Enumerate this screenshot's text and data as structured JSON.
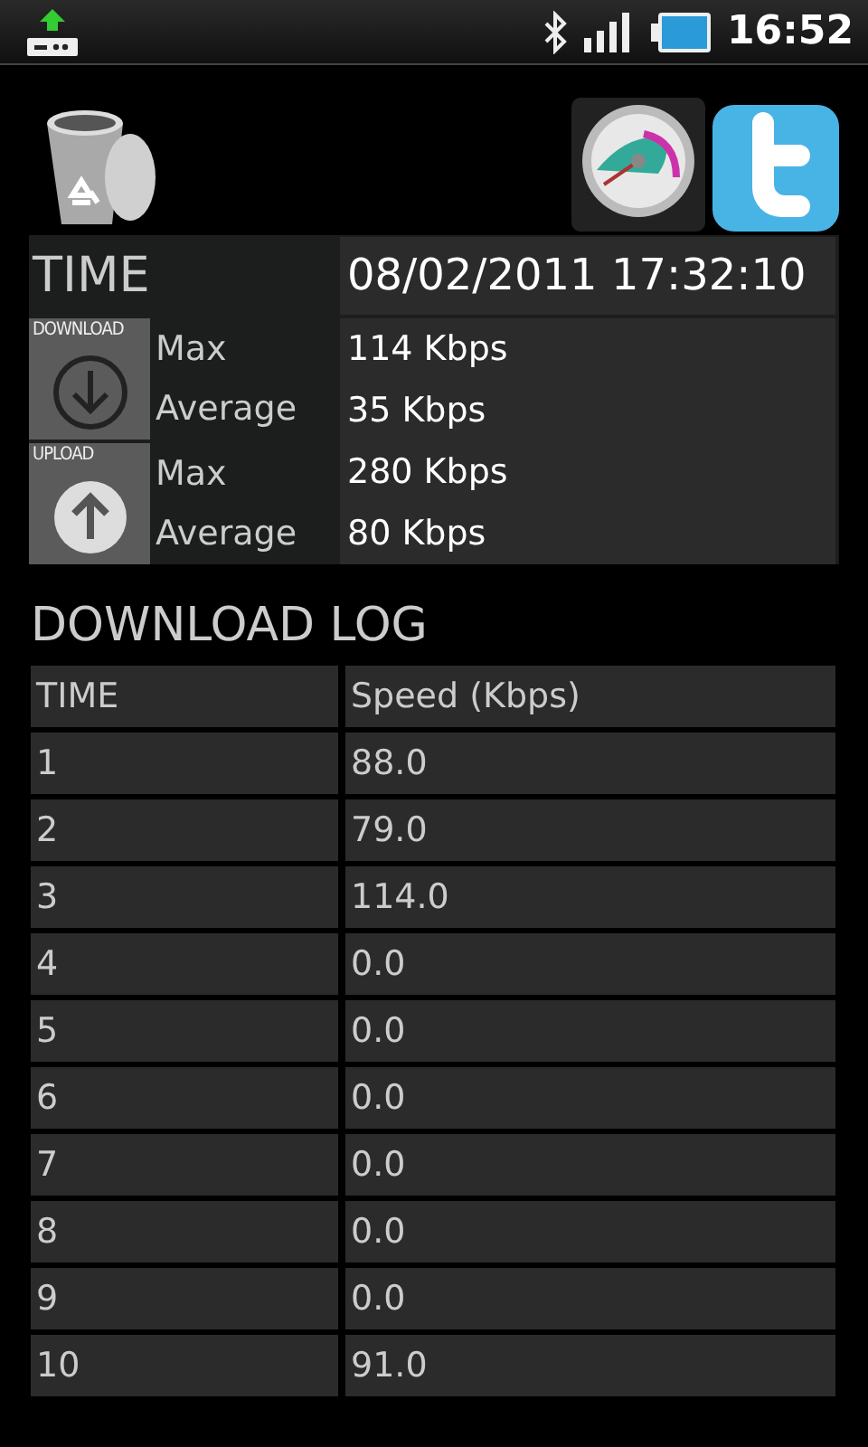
{
  "status_bar": {
    "time": "16:52"
  },
  "summary": {
    "time_label": "TIME",
    "time_value": "08/02/2011 17:32:10",
    "groups": [
      {
        "kind": "download",
        "tile_label": "DOWNLOAD",
        "rows": [
          {
            "label": "Max",
            "value": "114 Kbps"
          },
          {
            "label": "Average",
            "value": "35 Kbps"
          }
        ]
      },
      {
        "kind": "upload",
        "tile_label": "UPLOAD",
        "rows": [
          {
            "label": "Max",
            "value": "280 Kbps"
          },
          {
            "label": "Average",
            "value": "80 Kbps"
          }
        ]
      }
    ]
  },
  "log": {
    "title": "DOWNLOAD LOG",
    "columns": [
      "TIME",
      "Speed (Kbps)"
    ],
    "rows": [
      [
        "1",
        "88.0"
      ],
      [
        "2",
        "79.0"
      ],
      [
        "3",
        "114.0"
      ],
      [
        "4",
        "0.0"
      ],
      [
        "5",
        "0.0"
      ],
      [
        "6",
        "0.0"
      ],
      [
        "7",
        "0.0"
      ],
      [
        "8",
        "0.0"
      ],
      [
        "9",
        "0.0"
      ],
      [
        "10",
        "91.0"
      ]
    ]
  }
}
